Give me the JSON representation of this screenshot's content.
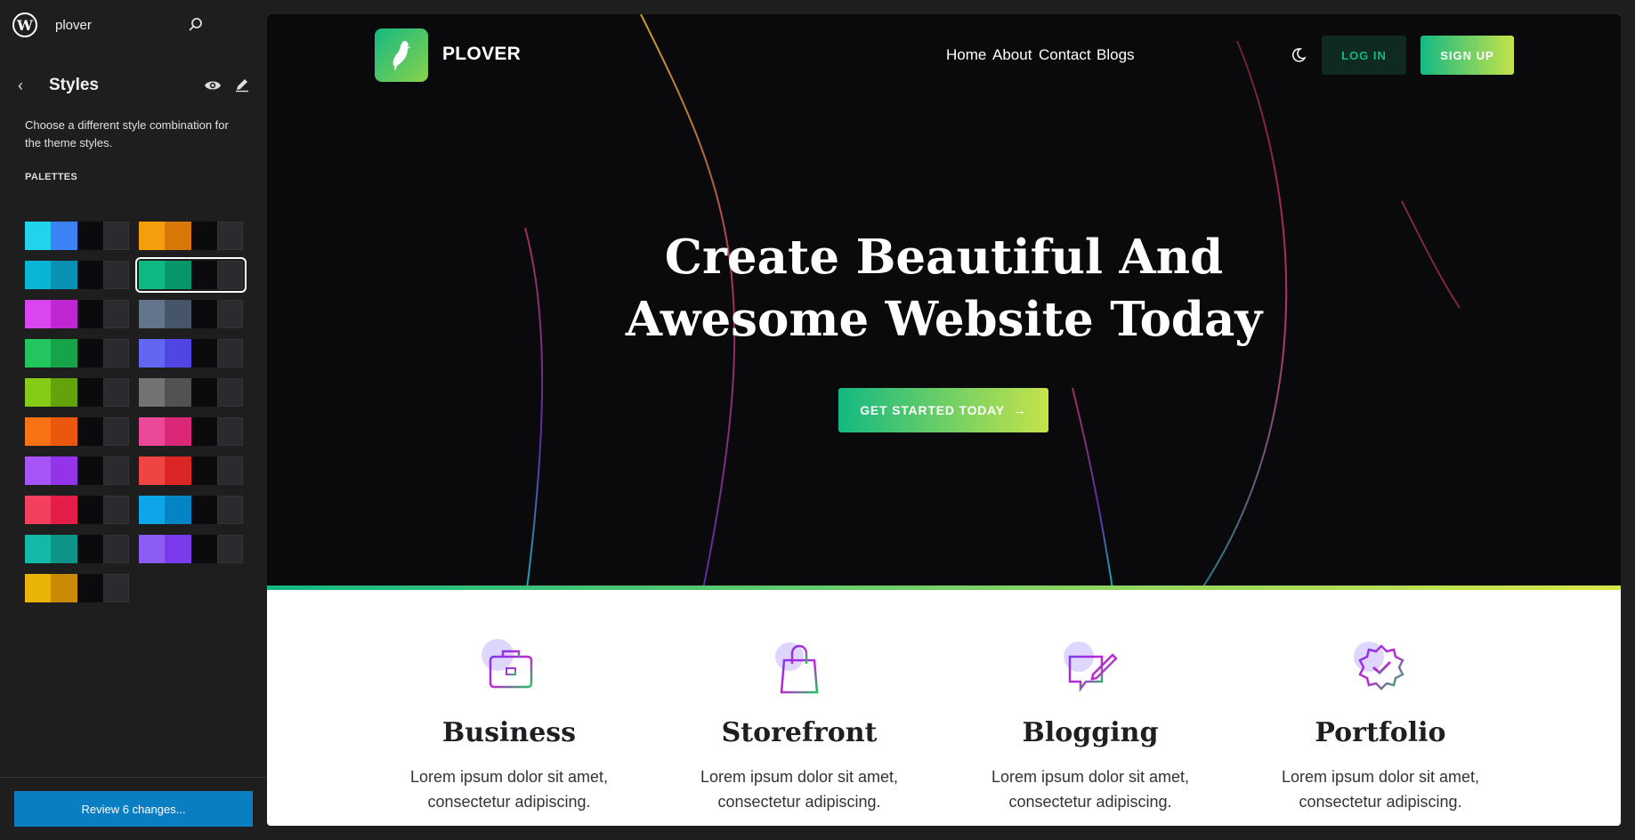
{
  "sidebar": {
    "site_name": "plover",
    "styles_title": "Styles",
    "styles_description": "Choose a different style combination for the theme styles.",
    "palettes_heading": "PALETTES",
    "review_button": "Review 6 changes...",
    "palettes": [
      [
        "#22d3ee",
        "#3b82f6",
        "#0b0b0d",
        "#2b2b2f"
      ],
      [
        "#f59e0b",
        "#d97706",
        "#0b0b0d",
        "#2b2b2f"
      ],
      [
        "#06b6d4",
        "#0891b2",
        "#0b0b0d",
        "#2b2b2f"
      ],
      [
        "#10b981",
        "#059669",
        "#0b0b0d",
        "#2b2b2f"
      ],
      [
        "#d946ef",
        "#c026d3",
        "#0b0b0d",
        "#2b2b2f"
      ],
      [
        "#64748b",
        "#475569",
        "#0b0b0d",
        "#2b2b2f"
      ],
      [
        "#22c55e",
        "#16a34a",
        "#0b0b0d",
        "#2b2b2f"
      ],
      [
        "#6366f1",
        "#4f46e5",
        "#0b0b0d",
        "#2b2b2f"
      ],
      [
        "#84cc16",
        "#65a30d",
        "#0b0b0d",
        "#2b2b2f"
      ],
      [
        "#737373",
        "#525252",
        "#0b0b0d",
        "#2b2b2f"
      ],
      [
        "#f97316",
        "#ea580c",
        "#0b0b0d",
        "#2b2b2f"
      ],
      [
        "#ec4899",
        "#db2777",
        "#0b0b0d",
        "#2b2b2f"
      ],
      [
        "#a855f7",
        "#9333ea",
        "#0b0b0d",
        "#2b2b2f"
      ],
      [
        "#ef4444",
        "#dc2626",
        "#0b0b0d",
        "#2b2b2f"
      ],
      [
        "#f43f5e",
        "#e11d48",
        "#0b0b0d",
        "#2b2b2f"
      ],
      [
        "#0ea5e9",
        "#0284c7",
        "#0b0b0d",
        "#2b2b2f"
      ],
      [
        "#14b8a6",
        "#0d9488",
        "#0b0b0d",
        "#2b2b2f"
      ],
      [
        "#8b5cf6",
        "#7c3aed",
        "#0b0b0d",
        "#2b2b2f"
      ],
      [
        "#eab308",
        "#ca8a04",
        "#0b0b0d",
        "#2b2b2f"
      ]
    ],
    "selected_palette_index": 3
  },
  "site": {
    "brand": "PLOVER",
    "nav": [
      "Home",
      "About",
      "Contact",
      "Blogs"
    ],
    "login": "LOG IN",
    "signup": "SIGN UP",
    "hero_title_line1": "Create Beautiful And",
    "hero_title_line2": "Awesome Website Today",
    "cta": "GET STARTED TODAY",
    "features": [
      {
        "title": "Business",
        "text1": "Lorem ipsum dolor sit amet,",
        "text2": "consectetur adipiscing.",
        "icon": "briefcase-icon"
      },
      {
        "title": "Storefront",
        "text1": "Lorem ipsum dolor sit amet,",
        "text2": "consectetur adipiscing.",
        "icon": "shopping-bag-icon"
      },
      {
        "title": "Blogging",
        "text1": "Lorem ipsum dolor sit amet,",
        "text2": "consectetur adipiscing.",
        "icon": "blog-edit-icon"
      },
      {
        "title": "Portfolio",
        "text1": "Lorem ipsum dolor sit amet,",
        "text2": "consectetur adipiscing.",
        "icon": "badge-check-icon"
      }
    ]
  },
  "colors": {
    "accent_start": "#13b982",
    "accent_end": "#c6e34a",
    "review_button_bg": "#0a7ec2"
  }
}
